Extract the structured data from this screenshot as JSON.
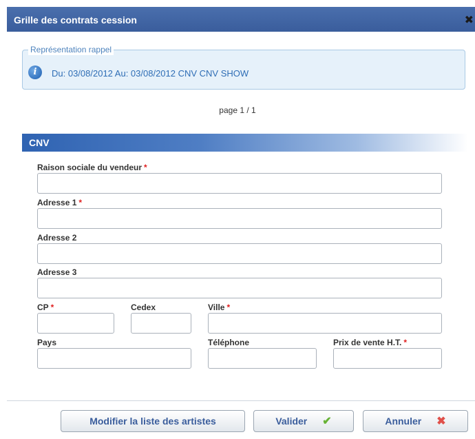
{
  "dialog": {
    "title": "Grille des contrats cession",
    "close_glyph": "✖"
  },
  "info": {
    "legend": "Représentation rappel",
    "text": "Du: 03/08/2012 Au: 03/08/2012 CNV CNV SHOW",
    "icon_glyph": "i"
  },
  "pager": {
    "text": "page 1 / 1"
  },
  "section": {
    "title": "CNV"
  },
  "form": {
    "required_mark": "*",
    "raison_sociale": {
      "label": "Raison sociale du vendeur",
      "value": ""
    },
    "adresse1": {
      "label": "Adresse 1",
      "value": ""
    },
    "adresse2": {
      "label": "Adresse 2",
      "value": ""
    },
    "adresse3": {
      "label": "Adresse 3",
      "value": ""
    },
    "cp": {
      "label": "CP",
      "value": ""
    },
    "cedex": {
      "label": "Cedex",
      "value": ""
    },
    "ville": {
      "label": "Ville",
      "value": ""
    },
    "pays": {
      "label": "Pays",
      "value": ""
    },
    "telephone": {
      "label": "Téléphone",
      "value": ""
    },
    "prix": {
      "label": "Prix de vente H.T.",
      "value": ""
    }
  },
  "buttons": {
    "modifier": "Modifier la liste des artistes",
    "valider": "Valider",
    "annuler": "Annuler",
    "valider_icon": "✔",
    "annuler_icon": "✖"
  },
  "colors": {
    "titlebar": "#3a5d9c",
    "required": "#e02020",
    "info_text": "#2e6db5",
    "check": "#67b335",
    "cross": "#e0504a"
  }
}
